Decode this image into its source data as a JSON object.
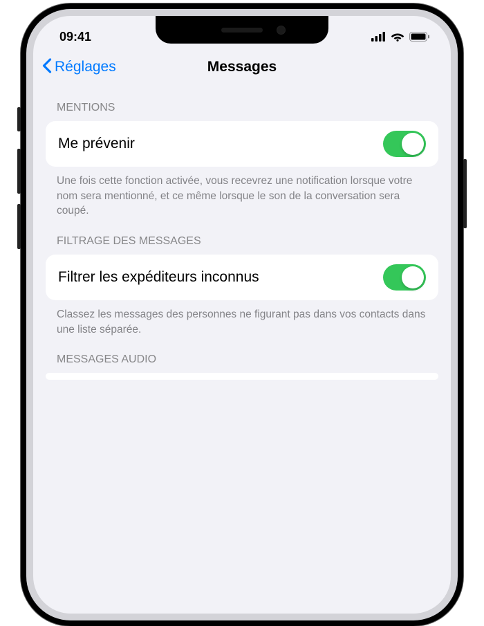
{
  "status": {
    "time": "09:41"
  },
  "nav": {
    "back_label": "Réglages",
    "title": "Messages"
  },
  "sections": {
    "mentions": {
      "header": "MENTIONS",
      "row_label": "Me prévenir",
      "toggle_on": true,
      "footer": "Une fois cette fonction activée, vous recevrez une notification lorsque votre nom sera mentionné, et ce même lorsque le son de la conversation sera coupé."
    },
    "filtering": {
      "header": "FILTRAGE DES MESSAGES",
      "row_label": "Filtrer les expéditeurs inconnus",
      "toggle_on": true,
      "footer": "Classez les messages des personnes ne figurant pas dans vos contacts dans une liste séparée."
    },
    "audio": {
      "header": "MESSAGES AUDIO"
    }
  },
  "colors": {
    "accent_blue": "#007aff",
    "toggle_green": "#34c759",
    "bg": "#f2f2f7",
    "secondary_text": "#838387"
  }
}
